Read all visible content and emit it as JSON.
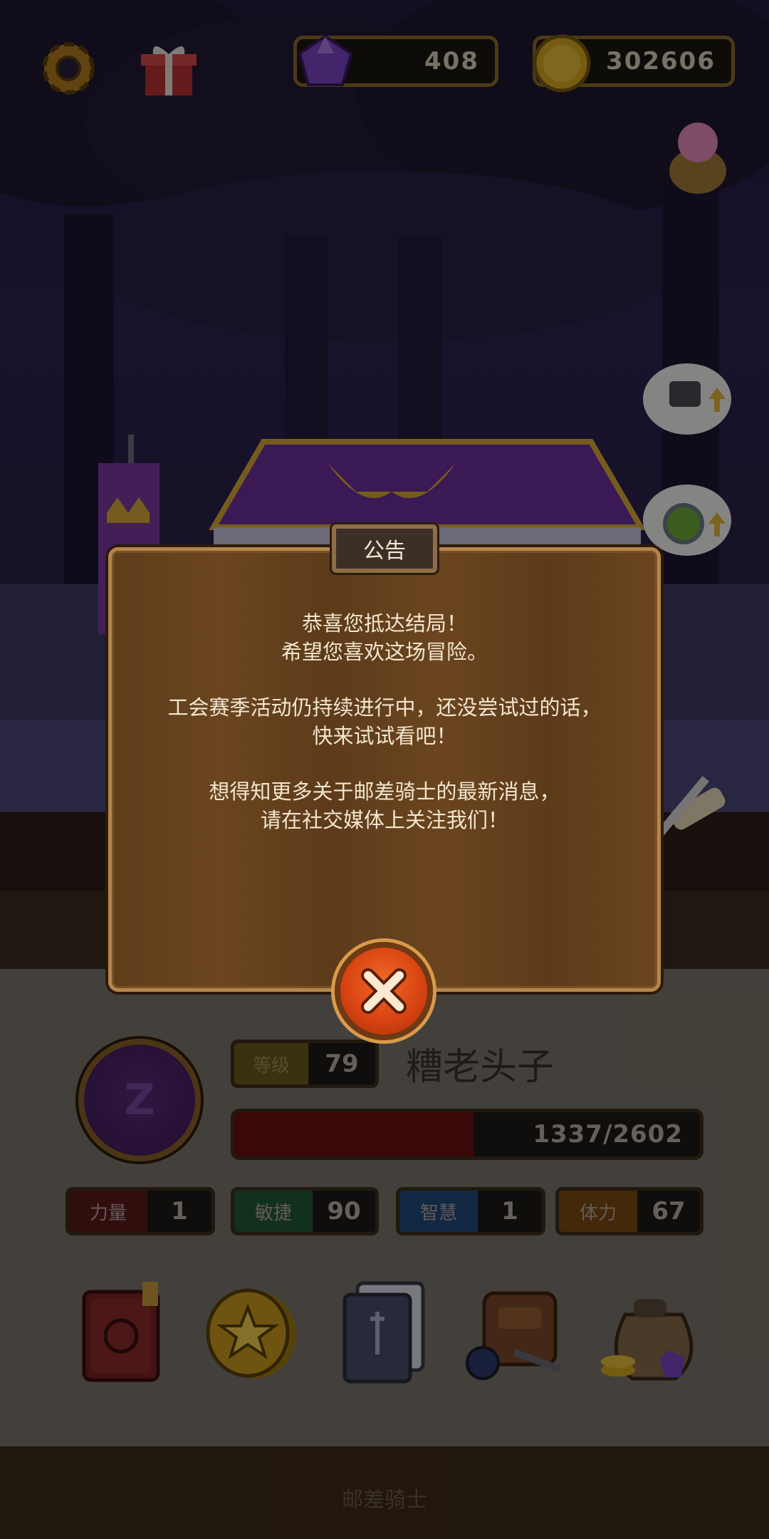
{
  "hud": {
    "gems": "408",
    "coins": "302606"
  },
  "dialog": {
    "title": "公告",
    "lines": [
      "恭喜您抵达结局！",
      "希望您喜欢这场冒险。",
      "",
      "工会赛季活动仍持续进行中，还没尝试过的话，",
      "快来试试看吧！",
      "",
      "想得知更多关于邮差骑士的最新消息，",
      "请在社交媒体上关注我们！"
    ]
  },
  "player": {
    "emblem_letter": "Z",
    "level_label": "等级",
    "level": "79",
    "name": "糟老头子",
    "hp_text": "1337/2602",
    "hp_fraction": 0.514
  },
  "stats": [
    {
      "label": "力量",
      "value": "1"
    },
    {
      "label": "敏捷",
      "value": "90"
    },
    {
      "label": "智慧",
      "value": "1"
    },
    {
      "label": "体力",
      "value": "67"
    }
  ],
  "menu": [
    "journal-book-icon",
    "star-coin-icon",
    "cards-icon",
    "backpack-icon",
    "loot-bag-icon"
  ],
  "footer": {
    "title": "邮差骑士"
  },
  "colors": {
    "accent_orange": "#d94412",
    "hp_red": "#6a1010",
    "wood": "#5f3d1b"
  }
}
